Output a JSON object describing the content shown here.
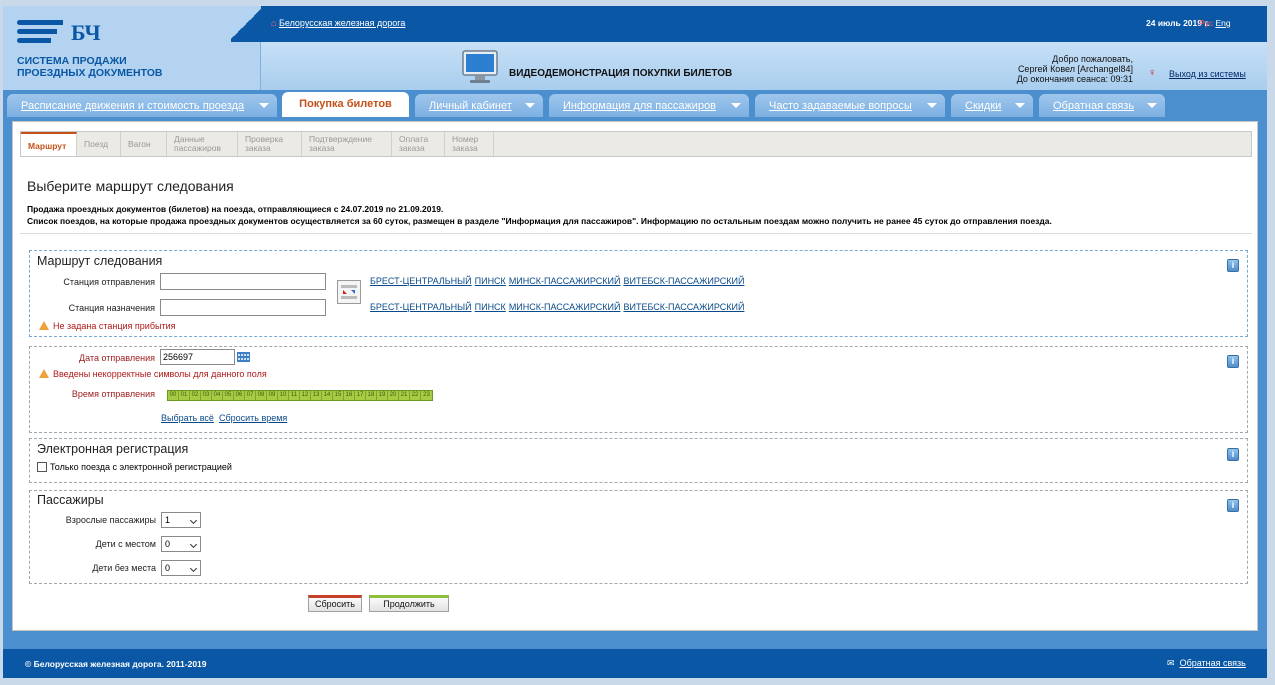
{
  "header": {
    "logo_mark": "БЧ",
    "logo_line1": "СИСТЕМА ПРОДАЖИ",
    "logo_line2": "ПРОЕЗДНЫХ ДОКУМЕНТОВ",
    "home_link": "Белорусская железная дорога",
    "date": "24 июль 2019 г.",
    "lang_ru": "Рус",
    "lang_en": "Eng",
    "video_title": "ВИДЕОДЕМОНСТРАЦИЯ ПОКУПКИ БИЛЕТОВ",
    "welcome_line1": "Добро пожаловать,",
    "welcome_line2": "Сергей Ковел [Archangel84]",
    "welcome_line3": "До окончания сеанса: 09:31",
    "logout": "Выход из системы"
  },
  "nav": {
    "tabs": [
      {
        "label": "Расписание движения и стоимость проезда"
      },
      {
        "label": "Покупка билетов"
      },
      {
        "label": "Личный кабинет"
      },
      {
        "label": "Информация для пассажиров"
      },
      {
        "label": "Часто задаваемые вопросы"
      },
      {
        "label": "Скидки"
      },
      {
        "label": "Обратная связь"
      }
    ]
  },
  "steps": [
    {
      "l1": "Маршрут",
      "l2": ""
    },
    {
      "l1": "Поезд",
      "l2": ""
    },
    {
      "l1": "Вагон",
      "l2": ""
    },
    {
      "l1": "Данные",
      "l2": "пассажиров"
    },
    {
      "l1": "Проверка",
      "l2": "заказа"
    },
    {
      "l1": "Подтверждение",
      "l2": "заказа"
    },
    {
      "l1": "Оплата",
      "l2": "заказа"
    },
    {
      "l1": "Номер",
      "l2": "заказа"
    }
  ],
  "main": {
    "title": "Выберите маршрут следования",
    "info1": "Продажа проездных документов (билетов) на поезда, отправляющиеся с 24.07.2019 по 21.09.2019.",
    "info2": "Список поездов, на которые продажа проездных документов осуществляется за 60 суток, размещен в разделе \"Информация для пассажиров\". Информацию по остальным поездам можно получить не ранее 45 суток до отправления поезда."
  },
  "route": {
    "title": "Маршрут следования",
    "departure_label": "Станция отправления",
    "departure_value": "",
    "arrival_label": "Станция назначения",
    "arrival_value": "",
    "quick_stations": [
      "БРЕСТ-ЦЕНТРАЛЬНЫЙ",
      "ПИНСК",
      "МИНСК-ПАССАЖИРСКИЙ",
      "ВИТЕБСК-ПАССАЖИРСКИЙ"
    ],
    "warning": "Не задана станция прибытия"
  },
  "datetime": {
    "date_label": "Дата отправления",
    "date_value": "256697",
    "warning": "Введены некорректные символы для данного поля",
    "time_label": "Время отправления",
    "hours": [
      "00",
      "01",
      "02",
      "03",
      "04",
      "05",
      "06",
      "07",
      "08",
      "09",
      "10",
      "11",
      "12",
      "13",
      "14",
      "15",
      "16",
      "17",
      "18",
      "19",
      "20",
      "21",
      "22",
      "23"
    ],
    "select_all": "Выбрать всё",
    "reset_time": "Сбросить время"
  },
  "ereg": {
    "title": "Электронная регистрация",
    "checkbox_label": "Только поезда с электронной регистрацией"
  },
  "passengers": {
    "title": "Пассажиры",
    "adults_label": "Взрослые пассажиры",
    "adults_value": "1",
    "children_label": "Дети с местом",
    "children_value": "0",
    "infants_label": "Дети без места",
    "infants_value": "0"
  },
  "buttons": {
    "reset": "Сбросить",
    "next": "Продолжить"
  },
  "footer": {
    "copyright": "© Белорусская железная дорога. 2011-2019",
    "feedback": "Обратная связь"
  },
  "colors": {
    "brand_blue": "#0a58a5",
    "accent_orange": "#c4511a",
    "hour_green": "#a7cc43"
  }
}
